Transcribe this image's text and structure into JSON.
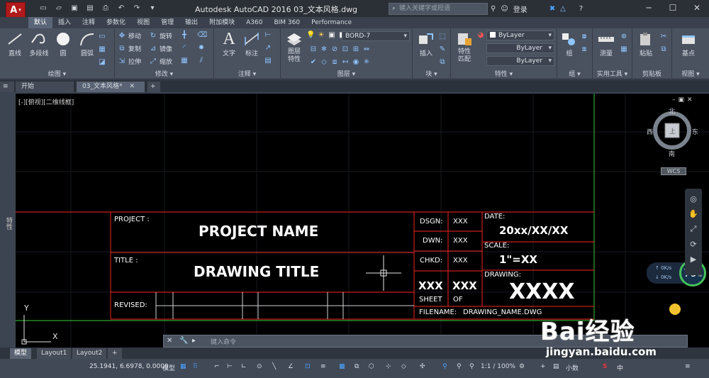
{
  "titlebar": {
    "app_button": "A",
    "title": "Autodesk AutoCAD 2016    03_文本风格.dwg",
    "search_placeholder": "键入关键字或短语",
    "login_label": "登录",
    "help_label": "?"
  },
  "ribbon_tabs": [
    "默认",
    "插入",
    "注释",
    "参数化",
    "视图",
    "管理",
    "输出",
    "附加模块",
    "A360",
    "BIM 360",
    "Performance"
  ],
  "ribbon": {
    "draw": {
      "title": "绘图",
      "line": "直线",
      "polyline": "多段线",
      "circle": "圆",
      "arc": "圆弧"
    },
    "modify": {
      "title": "修改",
      "move": "移动",
      "rotate": "旋转",
      "copy": "复制",
      "mirror": "镜像",
      "stretch": "拉伸",
      "scale": "缩放"
    },
    "annotation": {
      "title": "注释",
      "text": "文字",
      "dimension": "标注"
    },
    "layers": {
      "title": "图层",
      "layer_props": "图层\n特性",
      "current_layer": "BORD-7"
    },
    "block": {
      "title": "块",
      "insert": "插入"
    },
    "properties": {
      "title": "特性",
      "match": "特性\n匹配",
      "color": "ByLayer",
      "linetype": "ByLayer",
      "lineweight": "ByLayer"
    },
    "groups": {
      "title": "组",
      "group": "组"
    },
    "utilities": {
      "title": "实用工具",
      "measure": "测量"
    },
    "clipboard": {
      "title": "剪贴板",
      "paste": "粘贴"
    },
    "view": {
      "title": "视图",
      "base": "基点"
    }
  },
  "file_tabs": {
    "start": "开始",
    "current": "03_文本风格*",
    "add": "+"
  },
  "viewport": {
    "label": "[-][俯视][二维线框]",
    "ucs_x": "X",
    "ucs_y": "Y"
  },
  "viewcube": {
    "north": "北",
    "south": "南",
    "east": "东",
    "west": "西",
    "face": "上",
    "wcs": "WCS"
  },
  "titleblock": {
    "project_label": "PROJECT :",
    "project_name": "PROJECT NAME",
    "title_label": "TITLE :",
    "drawing_title": "DRAWING TITLE",
    "revised_label": "REVISED:",
    "dsgn_label": "DSGN:",
    "dsgn_val": "XXX",
    "dwn_label": "DWN:",
    "dwn_val": "XXX",
    "chkd_label": "CHKD:",
    "chkd_val": "XXX",
    "sheet_num": "XXX",
    "sheet_of": "XXX",
    "sheet_label": "SHEET",
    "of_label": "OF",
    "date_label": "DATE:",
    "date_val": "20xx/XX/XX",
    "scale_label": "SCALE:",
    "scale_val": "1\"=XX",
    "drawing_label": "DRAWING:",
    "drawing_val": "XXXX",
    "filename_label": "FILENAME:",
    "filename_val": "DRAWING_NAME.DWG"
  },
  "command_line": {
    "placeholder": "键入命令"
  },
  "layout_tabs": [
    "模型",
    "Layout1",
    "Layout2",
    "+"
  ],
  "status": {
    "coords": "25.1941, 6.6978, 0.0000",
    "model": "模型",
    "scale": "1:1 / 100%",
    "units": "小数"
  },
  "perf": {
    "percent": "79",
    "up": "0K/s",
    "down": "0K/s"
  },
  "watermark": {
    "brand": "Bai经验",
    "url": "jingyan.baidu.com"
  }
}
